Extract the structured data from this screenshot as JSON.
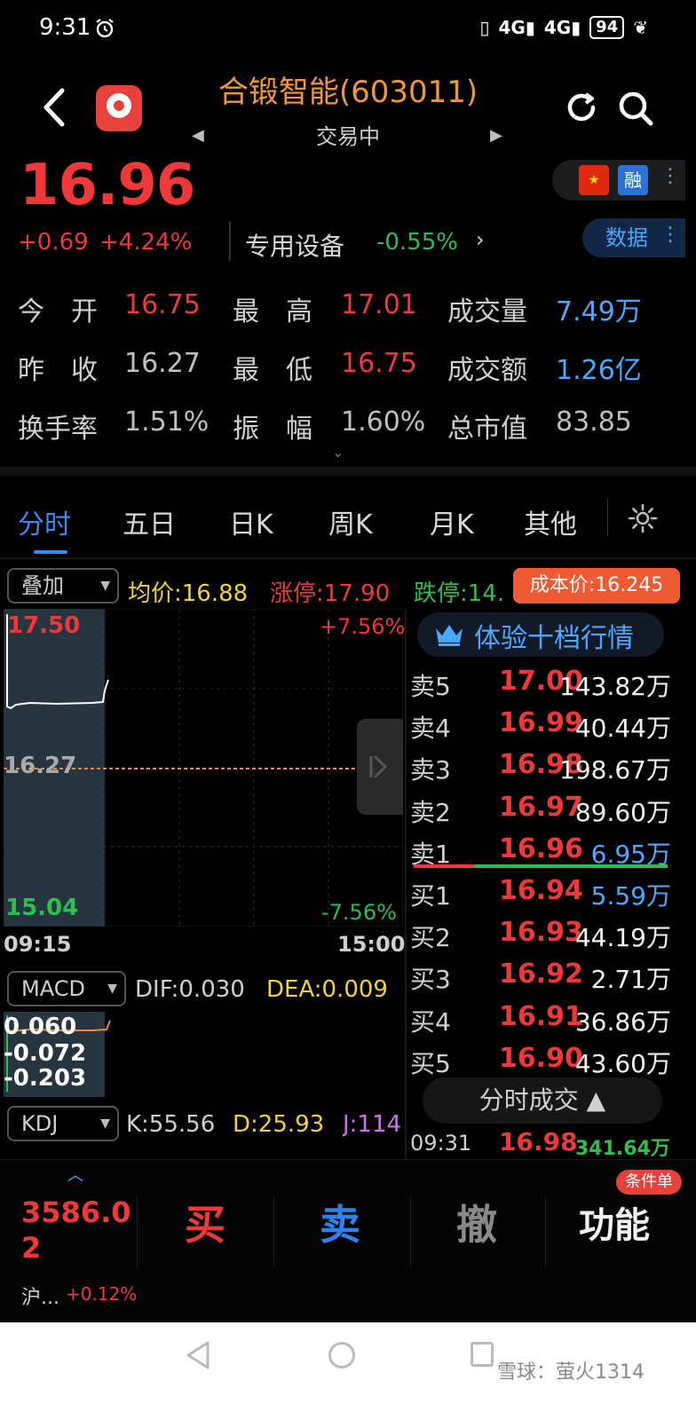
{
  "status_bar": {
    "time": "9:31",
    "network": "4G",
    "battery": "94"
  },
  "header": {
    "title": "合锻智能(603011)",
    "subtitle": "交易中",
    "prev_arrow": "◀",
    "next_arrow": "▶"
  },
  "quote": {
    "price": "16.96",
    "change": "+0.69",
    "change_pct": "+4.24%",
    "sector": "专用设备",
    "sector_change": "-0.55%",
    "sector_chevron": "›",
    "margin_badge": "融",
    "data_button": "数据"
  },
  "stats": {
    "open_label": "今　开",
    "open": "16.75",
    "high_label": "最　高",
    "high": "17.01",
    "volume_label": "成交量",
    "volume": "7.49万",
    "prev_close_label": "昨　收",
    "prev_close": "16.27",
    "low_label": "最　低",
    "low": "16.75",
    "turnover_label": "成交额",
    "turnover": "1.26亿",
    "turnover_rate_label": "换手率",
    "turnover_rate": "1.51%",
    "amplitude_label": "振　幅",
    "amplitude": "1.60%",
    "market_cap_label": "总市值",
    "market_cap": "83.85"
  },
  "tabs": [
    {
      "label": "分时",
      "active": true
    },
    {
      "label": "五日"
    },
    {
      "label": "日K"
    },
    {
      "label": "周K"
    },
    {
      "label": "月K"
    },
    {
      "label": "其他"
    }
  ],
  "overlay": {
    "dropdown": "叠加",
    "avg_price": "均价:16.88",
    "limit_up": "涨停:17.90",
    "limit_down": "跌停:14.",
    "cost_price": "成本价:16.245"
  },
  "chart": {
    "y_high": "17.50",
    "y_mid": "16.27",
    "y_low": "15.04",
    "pct_high": "+7.56%",
    "pct_low": "-7.56%",
    "time_start": "09:15",
    "time_end": "15:00",
    "colors": {
      "up": "#f03838",
      "down": "#2ebd4e",
      "avg": "#f0d23a",
      "prev_close_line": "#f08a3a"
    }
  },
  "macd": {
    "dropdown": "MACD",
    "dif": "DIF:0.030",
    "dea": "DEA:0.009",
    "v1": "0.060",
    "v2": "-0.072",
    "v3": "-0.203"
  },
  "kdj": {
    "dropdown": "KDJ",
    "k": "K:55.56",
    "d": "D:25.93",
    "j": "J:114"
  },
  "order_book": {
    "ten_level_label": "体验十档行情",
    "rows": [
      {
        "label": "卖5",
        "price": "17.00",
        "volume": "143.82万"
      },
      {
        "label": "卖4",
        "price": "16.99",
        "volume": "40.44万"
      },
      {
        "label": "卖3",
        "price": "16.98",
        "volume": "198.67万"
      },
      {
        "label": "卖2",
        "price": "16.97",
        "volume": "89.60万"
      },
      {
        "label": "卖1",
        "price": "16.96",
        "volume": "6.95万",
        "highlight": true
      },
      {
        "label": "买1",
        "price": "16.94",
        "volume": "5.59万",
        "highlight": true
      },
      {
        "label": "买2",
        "price": "16.93",
        "volume": "44.19万"
      },
      {
        "label": "买3",
        "price": "16.92",
        "volume": "2.71万"
      },
      {
        "label": "买4",
        "price": "16.91",
        "volume": "36.86万"
      },
      {
        "label": "买5",
        "price": "16.90",
        "volume": "43.60万"
      }
    ],
    "tick_button": "分时成交 ▲",
    "tick": {
      "time": "09:31",
      "price": "16.98",
      "volume": "341.64万"
    }
  },
  "bottom_bar": {
    "index_value": "3586.02",
    "index_name": "沪...",
    "index_change": "+0.12%",
    "buy": "买",
    "sell": "卖",
    "cancel": "撤",
    "functions": "功能",
    "conditional_order": "条件单"
  },
  "watermark": "雪球：萤火1314"
}
